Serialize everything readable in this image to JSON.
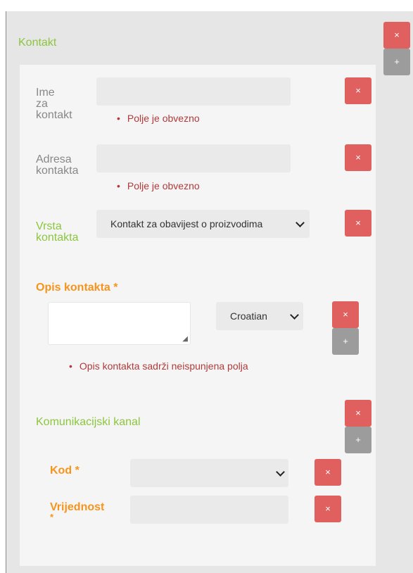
{
  "contact_section": {
    "title": "Kontakt"
  },
  "buttons": {
    "delete": "×",
    "add": "+"
  },
  "fields": {
    "contact_name": {
      "label": "Ime za kontakt",
      "label_lines": [
        "Ime",
        "za",
        "kontakt"
      ],
      "value": "",
      "error": "Polje je obvezno"
    },
    "contact_address": {
      "label": "Adresa kontakta",
      "label_lines": [
        "Adresa",
        "kontakta"
      ],
      "value": "",
      "error": "Polje je obvezno"
    },
    "contact_type": {
      "label": "Vrsta kontakta",
      "label_lines": [
        "Vrsta",
        "kontakta"
      ],
      "selected": "Kontakt za obavijest o proizvodima"
    }
  },
  "description": {
    "label": "Opis kontakta",
    "required_marker": "*",
    "value": "",
    "language": "Croatian",
    "error": "Opis kontakta sadrži neispunjena polja"
  },
  "channel": {
    "title": "Komunikacijski kanal",
    "code": {
      "label": "Kod",
      "required_marker": "*",
      "selected": ""
    },
    "value": {
      "label": "Vrijednost",
      "required_marker": "*",
      "value": ""
    }
  },
  "colors": {
    "green": "#8cc63f",
    "orange": "#f7941d",
    "delete_red": "#e06060",
    "add_grey": "#9c9c9c",
    "error": "#b03a3a"
  }
}
